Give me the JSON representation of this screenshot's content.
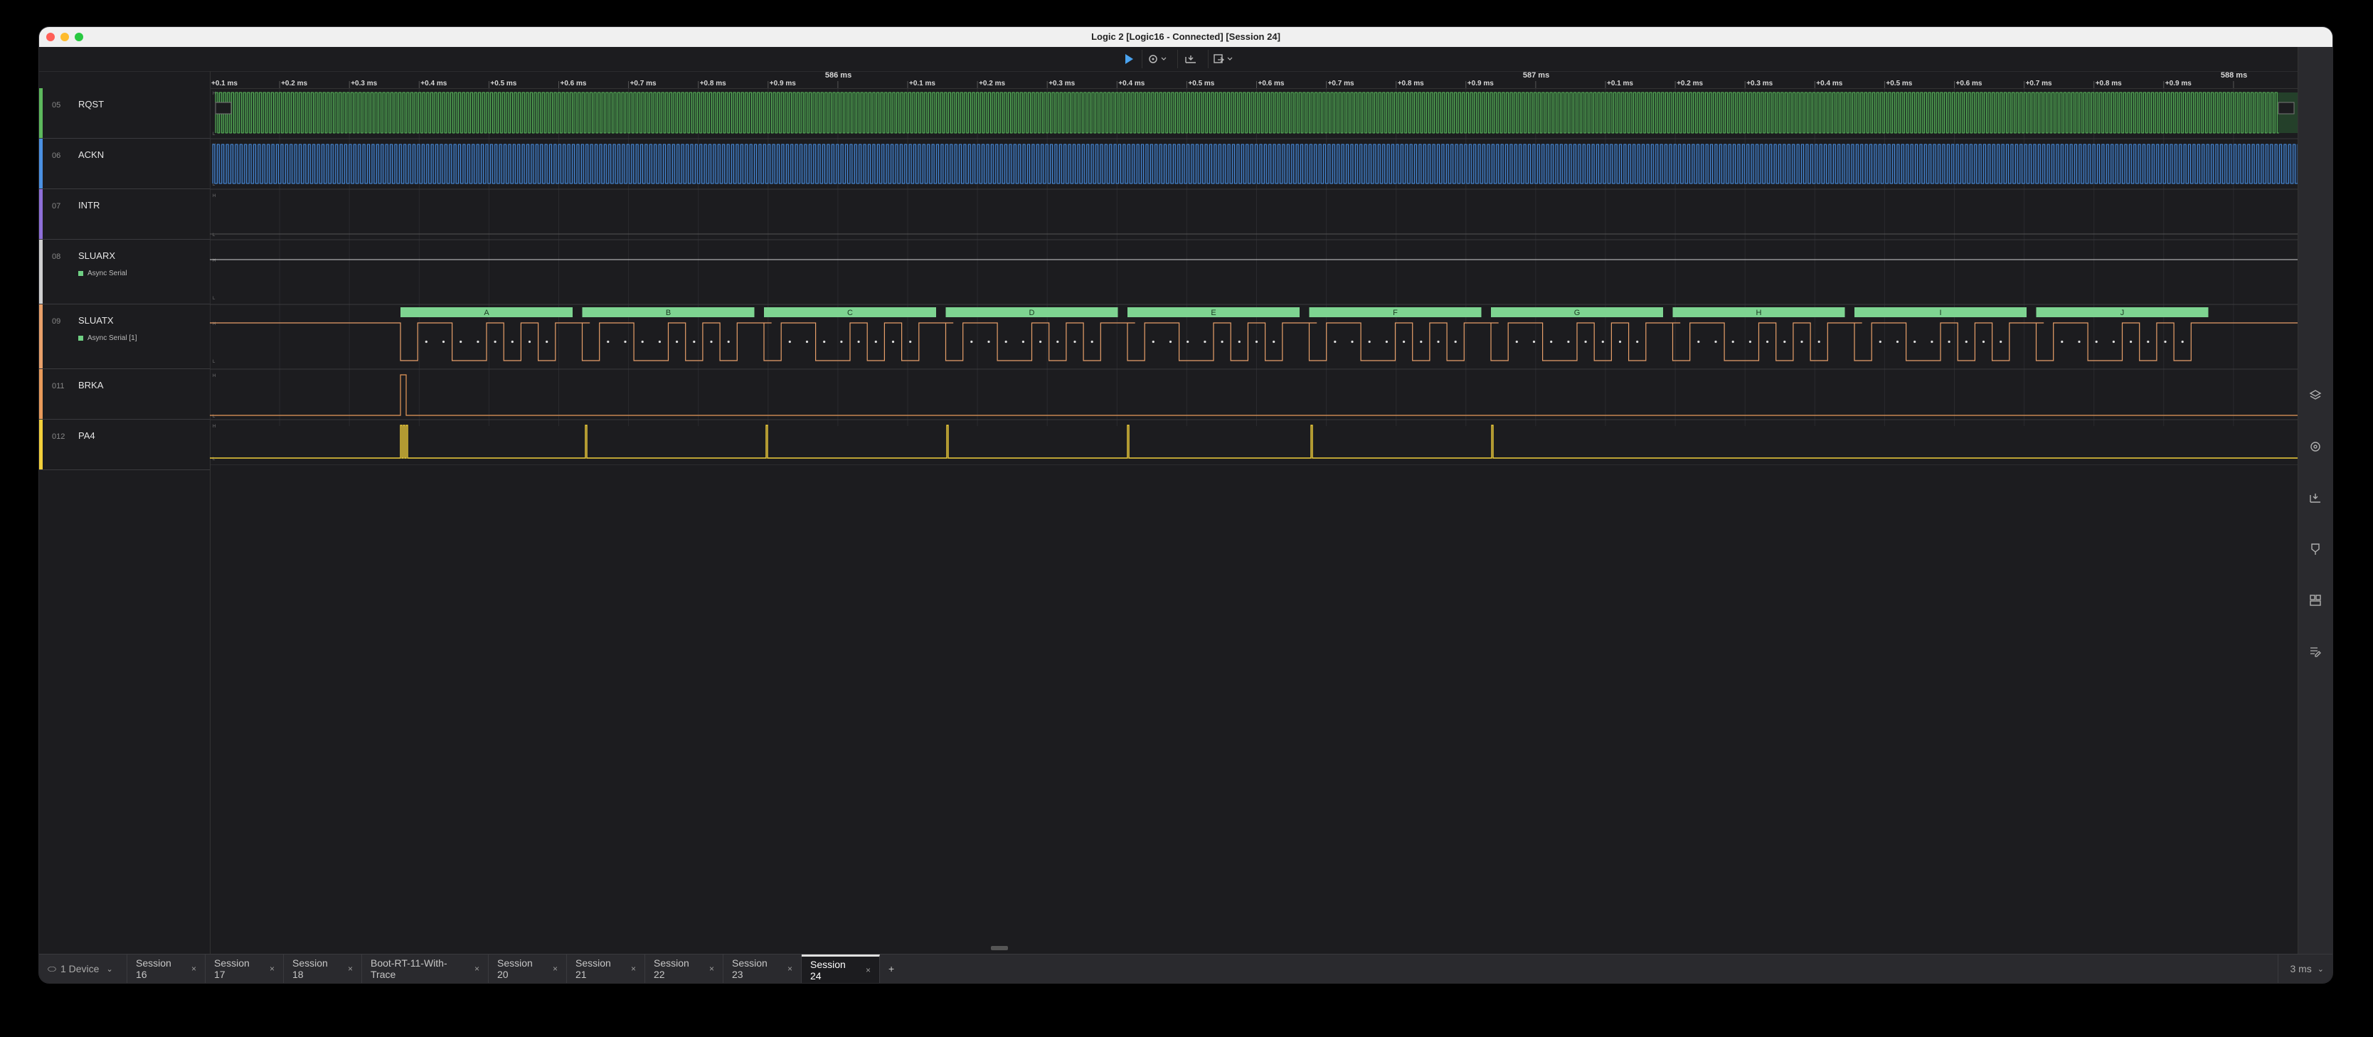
{
  "window": {
    "title": "Logic 2 [Logic16 - Connected] [Session 24]"
  },
  "toolbar": {
    "play_icon": "play-icon",
    "trigger_icon": "trigger-settings-icon",
    "measure_icon": "measure-icon",
    "capture_icon": "capture-options-icon"
  },
  "ruler": {
    "major_labels": [
      "586 ms",
      "587 ms",
      "588 ms"
    ],
    "minor_labels": [
      "+0.1 ms",
      "+0.2 ms",
      "+0.3 ms",
      "+0.4 ms",
      "+0.5 ms",
      "+0.6 ms",
      "+0.7 ms",
      "+0.8 ms",
      "+0.9 ms"
    ]
  },
  "channels": [
    {
      "num": "05",
      "name": "RQST",
      "color": "#5cb85c",
      "analyzer": ""
    },
    {
      "num": "06",
      "name": "ACKN",
      "color": "#4a90e2",
      "analyzer": ""
    },
    {
      "num": "07",
      "name": "INTR",
      "color": "#8e6fd8",
      "analyzer": ""
    },
    {
      "num": "08",
      "name": "SLUARX",
      "color": "#d0d0d0",
      "analyzer": "Async Serial"
    },
    {
      "num": "09",
      "name": "SLUATX",
      "color": "#e8a06a",
      "analyzer": "Async Serial [1]"
    },
    {
      "num": "011",
      "name": "BRKA",
      "color": "#e89a5a",
      "analyzer": ""
    },
    {
      "num": "012",
      "name": "PA4",
      "color": "#f2d03b",
      "analyzer": ""
    }
  ],
  "decoded_frames": [
    "A",
    "B",
    "C",
    "D",
    "E",
    "F",
    "G",
    "H",
    "I",
    "J"
  ],
  "level_labels": {
    "high": "H",
    "low": "L"
  },
  "right_rail_icons": [
    "analyzers-icon",
    "settings-icon",
    "measurements-icon",
    "timing-markers-icon",
    "extensions-icon",
    "notes-icon"
  ],
  "tabs": {
    "device": "1 Device",
    "sessions": [
      "Session 16",
      "Session 17",
      "Session 18",
      "Boot-RT-11-With-Trace",
      "Session 20",
      "Session 21",
      "Session 22",
      "Session 23",
      "Session 24"
    ],
    "active": "Session 24",
    "close_glyph": "×",
    "add_glyph": "+",
    "time_scale": "3 ms"
  }
}
